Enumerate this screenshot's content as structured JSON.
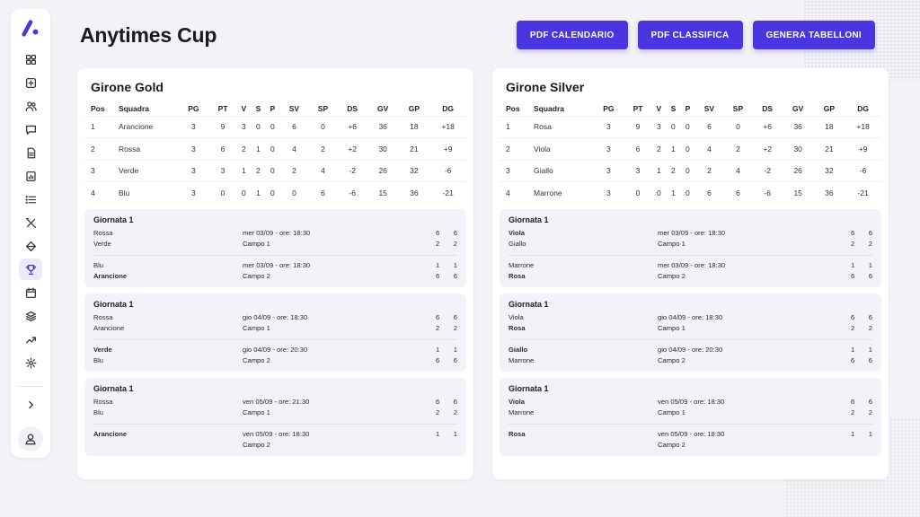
{
  "title": "Anytimes Cup",
  "actions": [
    "PDF CALENDARIO",
    "PDF CLASSIFICA",
    "GENERA TABELLONI"
  ],
  "columns": [
    "Pos",
    "Squadra",
    "PG",
    "PT",
    "V",
    "S",
    "P",
    "SV",
    "SP",
    "DS",
    "GV",
    "GP",
    "DG"
  ],
  "groups": [
    {
      "name": "Girone Gold",
      "standings": [
        [
          "1",
          "Arancione",
          "3",
          "9",
          "3",
          "0",
          "0",
          "6",
          "0",
          "+6",
          "36",
          "18",
          "+18"
        ],
        [
          "2",
          "Rossa",
          "3",
          "6",
          "2",
          "1",
          "0",
          "4",
          "2",
          "+2",
          "30",
          "21",
          "+9"
        ],
        [
          "3",
          "Verde",
          "3",
          "3",
          "1",
          "2",
          "0",
          "2",
          "4",
          "-2",
          "26",
          "32",
          "-6"
        ],
        [
          "4",
          "Blu",
          "3",
          "0",
          "0",
          "1",
          "0",
          "0",
          "6",
          "-6",
          "15",
          "36",
          "-21"
        ]
      ],
      "rounds": [
        {
          "title": "Giornata 1",
          "matches": [
            {
              "home": "Rossa",
              "away": "Verde",
              "home_bold": false,
              "away_bold": false,
              "date": "mer 03/09 - ore: 18:30",
              "field": "Campo 1",
              "home_sets": [
                "6",
                "6"
              ],
              "away_sets": [
                "2",
                "2"
              ]
            },
            {
              "home": "Blu",
              "away": "Arancione",
              "home_bold": false,
              "away_bold": true,
              "date": "mer 03/09 - ore: 18:30",
              "field": "Campo 2",
              "home_sets": [
                "1",
                "1"
              ],
              "away_sets": [
                "6",
                "6"
              ]
            }
          ]
        },
        {
          "title": "Giornata 1",
          "matches": [
            {
              "home": "Rossa",
              "away": "Arancione",
              "home_bold": false,
              "away_bold": false,
              "date": "gio 04/09 - ore: 18:30",
              "field": "Campo 1",
              "home_sets": [
                "6",
                "6"
              ],
              "away_sets": [
                "2",
                "2"
              ]
            },
            {
              "home": "Verde",
              "away": "Blu",
              "home_bold": true,
              "away_bold": false,
              "date": "gio 04/09 - ore: 20:30",
              "field": "Campo 2",
              "home_sets": [
                "1",
                "1"
              ],
              "away_sets": [
                "6",
                "6"
              ]
            }
          ]
        },
        {
          "title": "Giornata 1",
          "matches": [
            {
              "home": "Rossa",
              "away": "Blu",
              "home_bold": false,
              "away_bold": false,
              "date": "ven 05/09 - ore: 21:30",
              "field": "Campo 1",
              "home_sets": [
                "6",
                "6"
              ],
              "away_sets": [
                "2",
                "2"
              ]
            },
            {
              "home": "Arancione",
              "away": "",
              "home_bold": true,
              "away_bold": false,
              "date": "ven 05/09 - ore: 18:30",
              "field": "Campo 2",
              "home_sets": [
                "1",
                "1"
              ],
              "away_sets": [
                "",
                ""
              ]
            }
          ]
        }
      ]
    },
    {
      "name": "Girone Silver",
      "standings": [
        [
          "1",
          "Rosa",
          "3",
          "9",
          "3",
          "0",
          "0",
          "6",
          "0",
          "+6",
          "36",
          "18",
          "+18"
        ],
        [
          "2",
          "Viola",
          "3",
          "6",
          "2",
          "1",
          "0",
          "4",
          "2",
          "+2",
          "30",
          "21",
          "+9"
        ],
        [
          "3",
          "Giallo",
          "3",
          "3",
          "1",
          "2",
          "0",
          "2",
          "4",
          "-2",
          "26",
          "32",
          "-6"
        ],
        [
          "4",
          "Marrone",
          "3",
          "0",
          "0",
          "1",
          "0",
          "6",
          "6",
          "-6",
          "15",
          "36",
          "-21"
        ]
      ],
      "rounds": [
        {
          "title": "Giornata 1",
          "matches": [
            {
              "home": "Viola",
              "away": "Giallo",
              "home_bold": true,
              "away_bold": false,
              "date": "mer 03/09 - ore: 18:30",
              "field": "Campo 1",
              "home_sets": [
                "6",
                "6"
              ],
              "away_sets": [
                "2",
                "2"
              ]
            },
            {
              "home": "Marrone",
              "away": "Rosa",
              "home_bold": false,
              "away_bold": true,
              "date": "mer 03/09 - ore: 18:30",
              "field": "Campo 2",
              "home_sets": [
                "1",
                "1"
              ],
              "away_sets": [
                "6",
                "6"
              ]
            }
          ]
        },
        {
          "title": "Giornata 1",
          "matches": [
            {
              "home": "Viola",
              "away": "Rosa",
              "home_bold": false,
              "away_bold": true,
              "date": "gio 04/09 - ore: 18:30",
              "field": "Campo 1",
              "home_sets": [
                "6",
                "6"
              ],
              "away_sets": [
                "2",
                "2"
              ]
            },
            {
              "home": "Giallo",
              "away": "Marrone",
              "home_bold": true,
              "away_bold": false,
              "date": "gio 04/09 - ore: 20:30",
              "field": "Campo 2",
              "home_sets": [
                "1",
                "1"
              ],
              "away_sets": [
                "6",
                "6"
              ]
            }
          ]
        },
        {
          "title": "Giornata 1",
          "matches": [
            {
              "home": "Viola",
              "away": "Marrone",
              "home_bold": true,
              "away_bold": false,
              "date": "ven 05/09 - ore: 18:30",
              "field": "Campo 1",
              "home_sets": [
                "6",
                "6"
              ],
              "away_sets": [
                "2",
                "2"
              ]
            },
            {
              "home": "Rosa",
              "away": "",
              "home_bold": true,
              "away_bold": false,
              "date": "ven 05/09 - ore: 18:30",
              "field": "Campo 2",
              "home_sets": [
                "1",
                "1"
              ],
              "away_sets": [
                "",
                ""
              ]
            }
          ]
        }
      ]
    }
  ],
  "sidebar": {
    "items": [
      "dashboard-icon",
      "add-box-icon",
      "users-icon",
      "chat-icon",
      "document-icon",
      "report-icon",
      "list-icon",
      "tools-icon",
      "diamond-icon",
      "trophy-icon",
      "calendar-icon",
      "layers-icon",
      "trending-icon",
      "settings-icon"
    ],
    "active_index": 9
  },
  "colors": {
    "accent": "#4b35e0",
    "background": "#f3f3f7",
    "active_nav": "#ece9fb"
  }
}
